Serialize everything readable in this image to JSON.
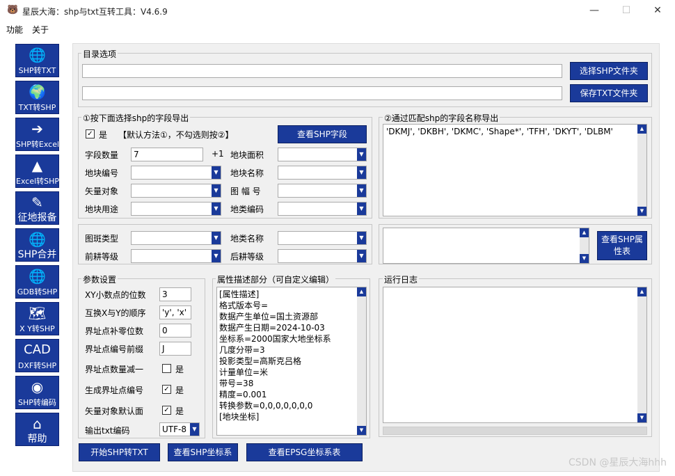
{
  "window": {
    "title": "星辰大海：shp与txt互转工具：V4.6.9",
    "min": "—",
    "max": "☐",
    "close": "✕"
  },
  "menu": [
    "功能",
    "关于"
  ],
  "sidebar": [
    {
      "label": "SHP转TXT",
      "icon": "🌐"
    },
    {
      "label": "TXT转SHP",
      "icon": "🌍"
    },
    {
      "label": "SHP转Excel",
      "icon": "➔"
    },
    {
      "label": "Excel转SHP",
      "icon": "▲"
    },
    {
      "label": "征地报备",
      "icon": "✎"
    },
    {
      "label": "SHP合并",
      "icon": "🌐"
    },
    {
      "label": "GDB转SHP",
      "icon": "🌐"
    },
    {
      "label": "X Y转SHP",
      "icon": "🗺"
    },
    {
      "label": "DXF转SHP",
      "icon": "CAD"
    },
    {
      "label": "SHP转编码",
      "icon": "◉"
    },
    {
      "label": "帮助",
      "icon": "⌂"
    }
  ],
  "dir": {
    "title": "目录选项",
    "shp_path": "",
    "txt_path": "",
    "select_shp_btn": "选择SHP文件夹",
    "save_txt_btn": "保存TXT文件夹"
  },
  "field1": {
    "title": "①按下面选择shp的字段导出",
    "checked": "✓",
    "check_label": "是",
    "default_note": "【默认方法①，不勾选则按②】",
    "view_btn": "查看SHP字段",
    "count_label": "字段数量",
    "count_value": "7",
    "plus": "+1",
    "rows": [
      {
        "l": "地块编号",
        "r": "地块面积"
      },
      {
        "l": "矢量对象",
        "r": "地块名称"
      },
      {
        "l": "地块用途",
        "r": "图 幅 号"
      }
    ],
    "r4": "地类编码"
  },
  "field1_labels": {
    "area": "地块面积",
    "name": "地块名称",
    "sheet": "图  幅  号",
    "code": "地类编码",
    "id": "地块编号",
    "vec": "矢量对象",
    "use": "地块用途"
  },
  "field2": {
    "title": "②通过匹配shp的字段名称导出",
    "text": "'DKMJ', 'DKBH', 'DKMC', 'Shape*', 'TFH', 'DKYT', 'DLBM'"
  },
  "extra": {
    "l1": "图斑类型",
    "r1": "地类名称",
    "l2": "前耕等级",
    "r2": "后耕等级",
    "attr_btn": "查看SHP属性表"
  },
  "params": {
    "title": "参数设置",
    "xy_digits_label": "XY小数点的位数",
    "xy_digits": "3",
    "swap_label": "互换X与Y的顺序",
    "swap": "'y', 'x'",
    "pad_label": "界址点补零位数",
    "pad": "0",
    "prefix_label": "界址点编号前缀",
    "prefix": "J",
    "minus_label": "界址点数量减一",
    "minus_yes": "是",
    "gen_label": "生成界址点编号",
    "gen_yes": "是",
    "vec_label": "矢量对象默认面",
    "vec_yes": "是",
    "enc_label": "输出txt编码",
    "enc": "UTF-8"
  },
  "attr": {
    "title": "属性描述部分（可自定义编辑）",
    "lines": [
      "[属性描述]",
      "格式版本号=",
      "数据产生单位=国土资源部",
      "数据产生日期=2024-10-03",
      "坐标系=2000国家大地坐标系",
      "几度分带=3",
      "投影类型=高斯克吕格",
      "计量单位=米",
      "带号=38",
      "精度=0.001",
      "转换参数=0,0,0,0,0,0,0",
      "[地块坐标]"
    ]
  },
  "log": {
    "title": "运行日志"
  },
  "bottom": {
    "start": "开始SHP转TXT",
    "view_coord": "查看SHP坐标系",
    "view_epsg": "查看EPSG坐标系表"
  },
  "watermark": "CSDN @星辰大海hhh"
}
